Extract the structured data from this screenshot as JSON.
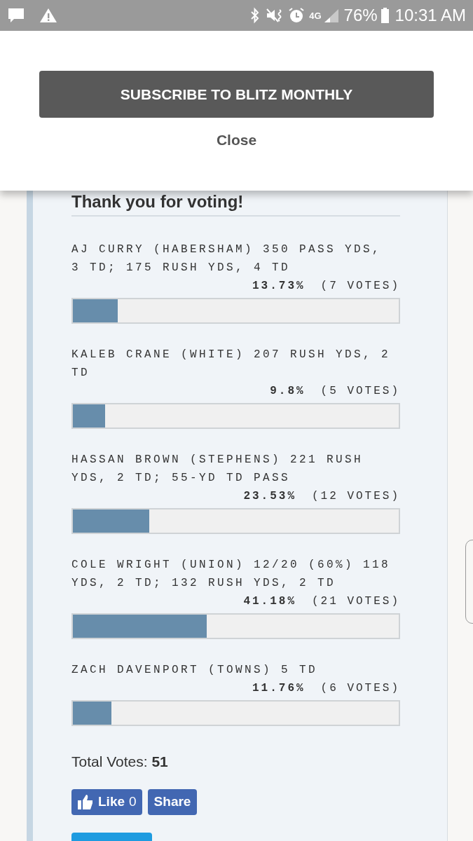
{
  "status_bar": {
    "network": "4G",
    "battery": "76%",
    "time": "10:31 AM"
  },
  "modal": {
    "subscribe_button": "SUBSCRIBE TO BLITZ MONTHLY",
    "close_button": "Close"
  },
  "poll": {
    "heading": "Thank you for voting!",
    "options": [
      {
        "label": "AJ CURRY (HABERSHAM) 350 PASS YDS, 3 TD; 175 RUSH YDS, 4 TD",
        "percent": "13.73%",
        "votes": "(7 VOTES)",
        "level": 0.1373
      },
      {
        "label": "KALEB CRANE (WHITE) 207 RUSH YDS, 2 TD",
        "percent": "9.8%",
        "votes": "(5 VOTES)",
        "level": 0.098
      },
      {
        "label": "HASSAN BROWN (STEPHENS) 221 RUSH YDS, 2 TD; 55-YD TD PASS",
        "percent": "23.53%",
        "votes": "(12 VOTES)",
        "level": 0.2353
      },
      {
        "label": "COLE WRIGHT (UNION) 12/20 (60%) 118 YDS, 2 TD; 132 RUSH YDS, 2 TD",
        "percent": "41.18%",
        "votes": "(21 VOTES)",
        "level": 0.4118
      },
      {
        "label": "ZACH DAVENPORT (TOWNS) 5 TD",
        "percent": "11.76%",
        "votes": "(6 VOTES)",
        "level": 0.1176
      }
    ],
    "total_label": "Total Votes:",
    "total": "51"
  },
  "social": {
    "like": "Like",
    "like_count": "0",
    "share": "Share"
  }
}
